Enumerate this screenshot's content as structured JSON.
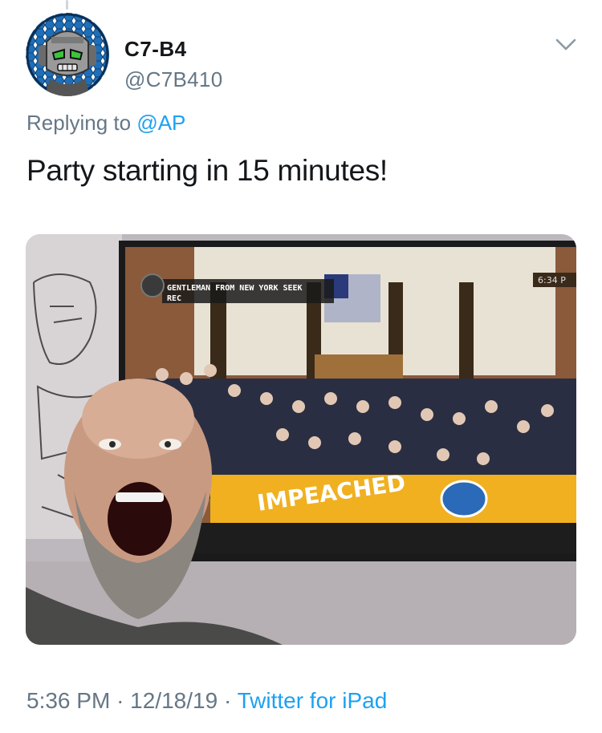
{
  "author": {
    "display_name": "C7-B4",
    "handle": "@C7B410",
    "avatar_icon": "robot-helmet-avatar-icon"
  },
  "reply": {
    "prefix": "Replying to",
    "mention": "@AP"
  },
  "tweet": {
    "text": "Party starting in 15 minutes!"
  },
  "media": {
    "tv_caption_line1": "GENTLEMAN FROM NEW YORK SEEK",
    "tv_caption_line2": "REC",
    "tv_banner_text": "IMPEACHED",
    "tv_corner_text": "6:34 P"
  },
  "footer": {
    "time": "5:36 PM",
    "date": "12/18/19",
    "separator": "·",
    "source": "Twitter for iPad"
  },
  "colors": {
    "text_primary": "#14171a",
    "text_secondary": "#657786",
    "link": "#1da1f2",
    "divider": "#ccd6dd"
  },
  "icons": {
    "menu": "chevron-down-icon"
  }
}
